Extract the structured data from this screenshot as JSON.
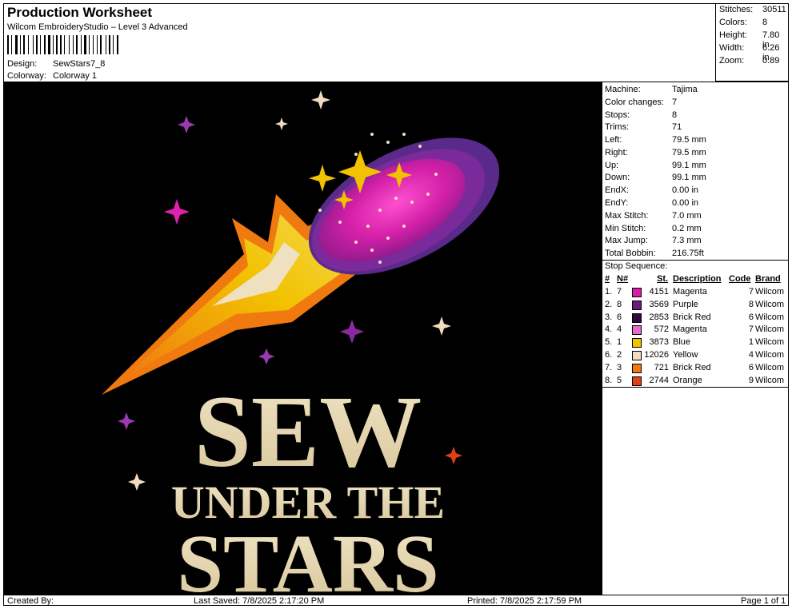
{
  "header": {
    "title": "Production Worksheet",
    "subtitle": "Wilcom EmbroideryStudio – Level 3 Advanced",
    "design_label": "Design:",
    "design_value": "SewStars7_8",
    "colorway_label": "Colorway:",
    "colorway_value": "Colorway 1"
  },
  "stats": [
    {
      "label": "Stitches:",
      "value": "30511"
    },
    {
      "label": "Colors:",
      "value": "8"
    },
    {
      "label": "Height:",
      "value": "7.80 in"
    },
    {
      "label": "Width:",
      "value": "6.26 in"
    },
    {
      "label": "Zoom:",
      "value": "0.89"
    }
  ],
  "machine_info": [
    {
      "label": "Machine:",
      "value": "Tajima"
    },
    {
      "label": "Color changes:",
      "value": "7"
    },
    {
      "label": "Stops:",
      "value": "8"
    },
    {
      "label": "Trims:",
      "value": "71"
    },
    {
      "label": "Left:",
      "value": "79.5 mm"
    },
    {
      "label": "Right:",
      "value": "79.5 mm"
    },
    {
      "label": "Up:",
      "value": "99.1 mm"
    },
    {
      "label": "Down:",
      "value": "99.1 mm"
    },
    {
      "label": "EndX:",
      "value": "0.00 in"
    },
    {
      "label": "EndY:",
      "value": "0.00 in"
    },
    {
      "label": "Max Stitch:",
      "value": "7.0 mm"
    },
    {
      "label": "Min Stitch:",
      "value": "0.2 mm"
    },
    {
      "label": "Max Jump:",
      "value": "7.3 mm"
    },
    {
      "label": "Total Bobbin:",
      "value": "216.75ft"
    }
  ],
  "stop_sequence": {
    "title": "Stop Sequence:",
    "headers": {
      "num": "#",
      "needle": "N#",
      "stitches": "St.",
      "description": "Description",
      "code": "Code",
      "brand": "Brand"
    },
    "rows": [
      {
        "num": "1.",
        "needle": "7",
        "color": "#d81ea8",
        "stitches": "4151",
        "description": "Magenta",
        "code": "7",
        "brand": "Wilcom"
      },
      {
        "num": "2.",
        "needle": "8",
        "color": "#6a1a7a",
        "stitches": "3569",
        "description": "Purple",
        "code": "8",
        "brand": "Wilcom"
      },
      {
        "num": "3.",
        "needle": "6",
        "color": "#2e0a3a",
        "stitches": "2853",
        "description": "Brick Red",
        "code": "6",
        "brand": "Wilcom"
      },
      {
        "num": "4.",
        "needle": "4",
        "color": "#e86ac8",
        "stitches": "572",
        "description": "Magenta",
        "code": "7",
        "brand": "Wilcom"
      },
      {
        "num": "5.",
        "needle": "1",
        "color": "#f2c200",
        "stitches": "3873",
        "description": "Blue",
        "code": "1",
        "brand": "Wilcom"
      },
      {
        "num": "6.",
        "needle": "2",
        "color": "#f2dcc0",
        "stitches": "12026",
        "description": "Yellow",
        "code": "4",
        "brand": "Wilcom"
      },
      {
        "num": "7.",
        "needle": "3",
        "color": "#f07a10",
        "stitches": "721",
        "description": "Brick Red",
        "code": "6",
        "brand": "Wilcom"
      },
      {
        "num": "8.",
        "needle": "5",
        "color": "#e04018",
        "stitches": "2744",
        "description": "Orange",
        "code": "9",
        "brand": "Wilcom"
      }
    ]
  },
  "design_text": {
    "line1": "SEW",
    "line2": "UNDER THE",
    "line3": "STARS"
  },
  "footer": {
    "created": "Created By:",
    "saved": "Last Saved: 7/8/2025 2:17:20 PM",
    "printed": "Printed: 7/8/2025 2:17:59 PM",
    "page": "Page 1 of 1"
  }
}
